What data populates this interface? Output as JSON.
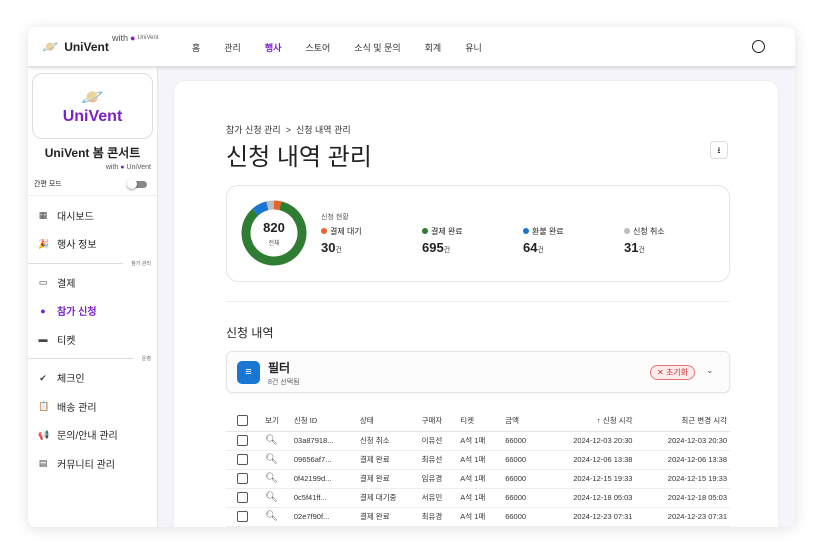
{
  "header": {
    "logo": "UniVent",
    "with": "with",
    "with_brand": "UniVent",
    "nav": [
      "홈",
      "관리",
      "행사",
      "스토어",
      "소식 및 문의",
      "회계",
      "유니"
    ],
    "active_nav": "행사"
  },
  "sidebar": {
    "brand": "UniVent",
    "event_title": "UniVent 봄 콘서트",
    "with": "with",
    "with_brand": "UniVent",
    "simple_mode": "간편 모드",
    "items_a": [
      {
        "label": "대시보드",
        "icon": "dashboard-icon"
      },
      {
        "label": "행사 정보",
        "icon": "celebration-icon"
      }
    ],
    "section_b": "참가 관리",
    "items_b": [
      {
        "label": "결제",
        "icon": "credit-card-icon"
      },
      {
        "label": "참가 신청",
        "icon": "person-icon"
      },
      {
        "label": "티켓",
        "icon": "ticket-icon"
      }
    ],
    "section_c": "운영",
    "items_c": [
      {
        "label": "체크인",
        "icon": "check-circle-icon"
      },
      {
        "label": "배송 관리",
        "icon": "clipboard-icon"
      },
      {
        "label": "문의/안내 관리",
        "icon": "campaign-icon"
      },
      {
        "label": "커뮤니티 관리",
        "icon": "forum-icon"
      }
    ]
  },
  "main": {
    "breadcrumb": [
      "참가 신청 관리",
      "신청 내역 관리"
    ],
    "title": "신청 내역 관리",
    "stats": {
      "total": "820",
      "total_label": "전체",
      "label": "신청 현황",
      "unit": "건",
      "items": [
        {
          "label": "결제 대기",
          "value": 30,
          "color": "#e8622c"
        },
        {
          "label": "결제 완료",
          "value": 695,
          "color": "#2e7d32"
        },
        {
          "label": "환불 완료",
          "value": 64,
          "color": "#1976d2"
        },
        {
          "label": "신청 취소",
          "value": 31,
          "color": "#bdbdbd"
        }
      ]
    },
    "list_title": "신청 내역",
    "filter": {
      "title": "필터",
      "subtitle": "8건 선택됨",
      "reset": "초기화"
    },
    "table": {
      "headers": [
        "보기",
        "신청 ID",
        "상태",
        "구매자",
        "티켓",
        "금액",
        "신청 시각",
        "최근 변경 시각"
      ],
      "rows": [
        [
          "03a87918...",
          "신청 취소",
          "이유선",
          "A석 1매",
          "66000",
          "2024-12-03 20:30",
          "2024-12-03 20:30"
        ],
        [
          "09656af7...",
          "결제 완료",
          "최유선",
          "A석 1매",
          "66000",
          "2024-12-06 13:38",
          "2024-12-06 13:38"
        ],
        [
          "0f42199d...",
          "결제 완료",
          "임유경",
          "A석 1매",
          "66000",
          "2024-12-15 19:33",
          "2024-12-15 19:33"
        ],
        [
          "0c5f41ff...",
          "결제 대기중",
          "서유민",
          "A석 1매",
          "66000",
          "2024-12-18 05:03",
          "2024-12-18 05:03"
        ],
        [
          "02e7f90f...",
          "결제 완료",
          "최유경",
          "A석 1매",
          "66000",
          "2024-12-23 07:31",
          "2024-12-23 07:31"
        ]
      ]
    }
  }
}
